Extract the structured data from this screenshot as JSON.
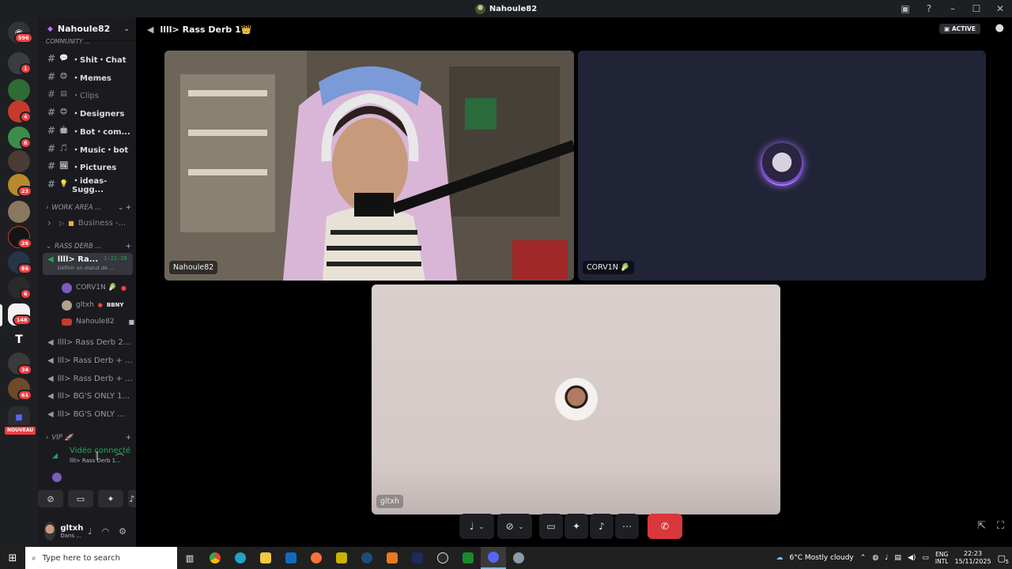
{
  "window": {
    "title": "Nahoule82"
  },
  "server": {
    "name": "Nahoule82",
    "community_label": "COMMUNITY ..."
  },
  "rail": {
    "items": [
      {
        "badge": "596",
        "color": "#5865f2"
      },
      {
        "badge": "1",
        "color": "#3a3c42"
      },
      {
        "badge": "",
        "color": "#2f6b35"
      },
      {
        "badge": "4",
        "color": "#c73a2c"
      },
      {
        "badge": "8",
        "color": "#3c8d4a"
      },
      {
        "badge": "",
        "color": "#4a3b33"
      },
      {
        "badge": "23",
        "color": "#b88a2a"
      },
      {
        "badge": "",
        "color": "#8a7760"
      },
      {
        "badge": "26",
        "color": "#141414"
      },
      {
        "badge": "86",
        "color": "#26344a"
      },
      {
        "badge": "6",
        "color": "#2a2a2a"
      },
      {
        "badge": "148",
        "color": "#f2f2f2"
      },
      {
        "badge": "",
        "color": "#1e1f22"
      },
      {
        "badge": "34",
        "color": "#3a3a3a"
      },
      {
        "badge": "61",
        "color": "#6e4a2a"
      }
    ],
    "new_label": "NOUVEAU"
  },
  "channels": [
    {
      "emoji": "💬",
      "name": "・Shit・Chat",
      "bold": true
    },
    {
      "emoji": "😊",
      "name": "・Memes",
      "bold": true
    },
    {
      "emoji": "▤",
      "name": "・Clips",
      "bold": false
    },
    {
      "emoji": "😊",
      "name": "・Designers",
      "bold": true
    },
    {
      "emoji": "🤖",
      "name": "・Bot・com...",
      "bold": true
    },
    {
      "emoji": "🎵",
      "name": "・Music・bot",
      "bold": true
    },
    {
      "emoji": "🖼",
      "name": "・Pictures",
      "bold": true
    },
    {
      "emoji": "💡",
      "name": "・ideas-Sugg...",
      "bold": true
    }
  ],
  "categories": {
    "work": "WORK AREA ...",
    "business": "Business -...",
    "rass": "RASS DERB ...",
    "vip": "VIP 🚀"
  },
  "voice_channels": {
    "active": {
      "name": "llll> Ra...",
      "timer": "1:22:28",
      "status": "Définir un statut de ..."
    },
    "members": [
      {
        "name": "CORV1N 🥬",
        "color": "#7c5cbf"
      },
      {
        "name": "gltxh",
        "tag": "BBNY",
        "color": "#b0a090"
      },
      {
        "name": "Nahoule82",
        "color": "#c73a2c"
      }
    ],
    "others": [
      "llll> Rass Derb 2...",
      "lll> Rass Derb + ...",
      "lll> Rass Derb + ...",
      "lll> BG'S ONLY 1...",
      "lll> BG'S ONLY ..."
    ]
  },
  "voice_panel": {
    "status": "Vidéo connecté",
    "channel": "llll> Rass Derb 1..."
  },
  "user": {
    "name": "gltxh",
    "status": "Dans ..."
  },
  "call": {
    "channel_title": "llll> Rass Derb 1👑",
    "activities_label": "ACTIVE",
    "tiles": [
      {
        "name": "Nahoule82"
      },
      {
        "name": "CORV1N 🥬"
      },
      {
        "name": "gltxh"
      }
    ]
  },
  "taskbar": {
    "search_placeholder": "Type here to search",
    "weather": "6°C  Mostly cloudy",
    "lang_top": "ENG",
    "lang_bottom": "INTL",
    "time": "22:23",
    "date": "15/11/2025",
    "notif_count": "5"
  }
}
